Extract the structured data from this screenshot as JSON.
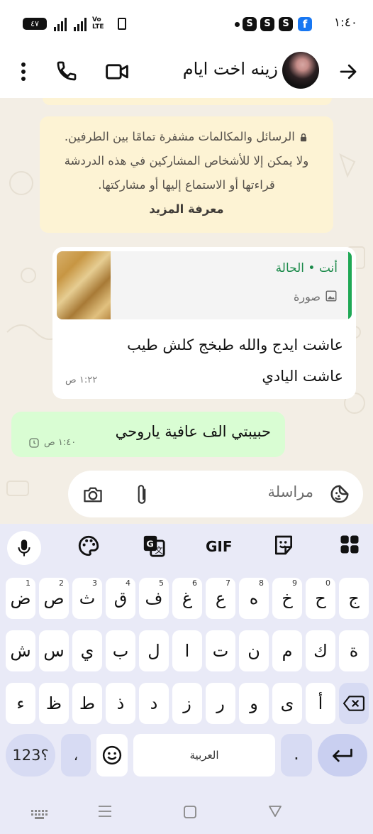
{
  "status_bar": {
    "time": "١:٤٠",
    "battery": "٤٧",
    "volte_line1": "Vo",
    "volte_line2": "LTE",
    "notification_letter": "S",
    "facebook_letter": "f"
  },
  "header": {
    "contact_name": "زينه اخت ايام"
  },
  "chat": {
    "encryption_notice": {
      "text": "الرسائل والمكالمات مشفرة تمامًا بين الطرفين. ولا يمكن إلا للأشخاص المشاركين في هذه الدردشة قراءتها أو الاستماع إليها أو مشاركتها.",
      "learn_more": "معرفة المزيد"
    },
    "incoming": {
      "quote_author": "أنت • الحالة",
      "quote_type": "صورة",
      "text_line1": "عاشت ايدج والله طبخج كلش طيب",
      "text_line2": "عاشت اليادي",
      "time": "١:٢٢ ص"
    },
    "outgoing": {
      "text": "حبيبتي الف عافية ياروحي",
      "time": "١:٤٠ ص"
    }
  },
  "composer": {
    "placeholder": "مراسلة"
  },
  "keyboard": {
    "toolbar": {
      "gif_label": "GIF"
    },
    "row1": [
      {
        "char": "ج",
        "hint": ""
      },
      {
        "char": "ح",
        "hint": "0"
      },
      {
        "char": "خ",
        "hint": "9"
      },
      {
        "char": "ه",
        "hint": "8"
      },
      {
        "char": "ع",
        "hint": "7"
      },
      {
        "char": "غ",
        "hint": "6"
      },
      {
        "char": "ف",
        "hint": "5"
      },
      {
        "char": "ق",
        "hint": "4"
      },
      {
        "char": "ث",
        "hint": "3"
      },
      {
        "char": "ص",
        "hint": "2"
      },
      {
        "char": "ض",
        "hint": "1"
      }
    ],
    "row2": [
      "ة",
      "ك",
      "م",
      "ن",
      "ت",
      "ا",
      "ل",
      "ب",
      "ي",
      "س",
      "ش"
    ],
    "row3": [
      "أ",
      "ى",
      "و",
      "ر",
      "ز",
      "د",
      "ذ",
      "ط",
      "ظ",
      "ء"
    ],
    "bottom": {
      "numbers_label": "؟123",
      "comma": "،",
      "space_label": "العربية",
      "period": "."
    }
  },
  "colors": {
    "accent_green": "#1faa59",
    "outgoing_bubble": "#d9fdd3",
    "notice_bg": "#fdf3d4",
    "keyboard_bg": "#e9eaf7"
  }
}
